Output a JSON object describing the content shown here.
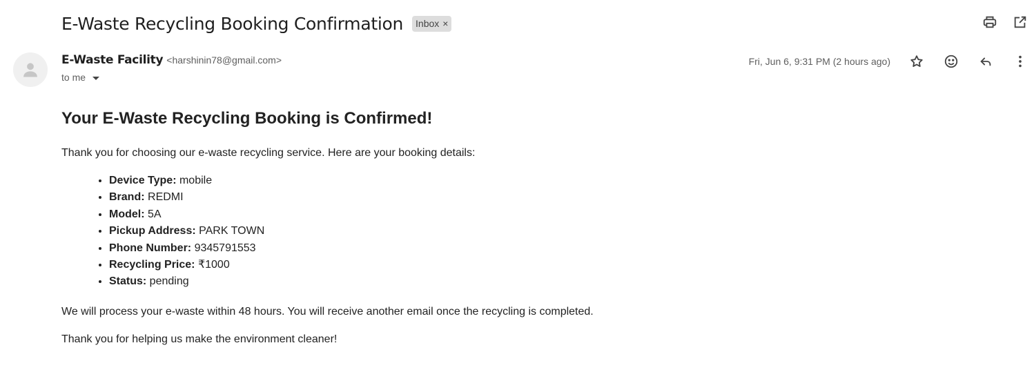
{
  "email": {
    "subject": "E-Waste Recycling Booking Confirmation",
    "label": "Inbox",
    "label_remove": "×",
    "sender_name": "E-Waste Facility",
    "sender_email": "<harshinin78@gmail.com>",
    "to_line": "to me",
    "date": "Fri, Jun 6, 9:31 PM (2 hours ago)"
  },
  "icons": {
    "print": "print-icon",
    "open_new_window": "open-in-new-window-icon",
    "star": "star-icon",
    "emoji": "emoji-reaction-icon",
    "reply": "reply-icon",
    "more": "more-vertical-icon",
    "avatar": "person-avatar-icon"
  },
  "body": {
    "heading": "Your E-Waste Recycling Booking is Confirmed!",
    "intro": "Thank you for choosing our e-waste recycling service. Here are your booking details:",
    "details": [
      {
        "label": "Device Type:",
        "value": " mobile"
      },
      {
        "label": "Brand:",
        "value": " REDMI"
      },
      {
        "label": "Model:",
        "value": " 5A"
      },
      {
        "label": "Pickup Address:",
        "value": " PARK TOWN"
      },
      {
        "label": "Phone Number:",
        "value": " 9345791553"
      },
      {
        "label": "Recycling Price:",
        "value": " ₹1000"
      },
      {
        "label": "Status:",
        "value": " pending"
      }
    ],
    "processing_note": "We will process your e-waste within 48 hours. You will receive another email once the recycling is completed.",
    "thanks": "Thank you for helping us make the environment cleaner!"
  },
  "colors": {
    "text": "#222222",
    "muted": "#5e5e5e",
    "chip_bg": "#dddddd",
    "avatar_bg": "#f0f0f0"
  }
}
